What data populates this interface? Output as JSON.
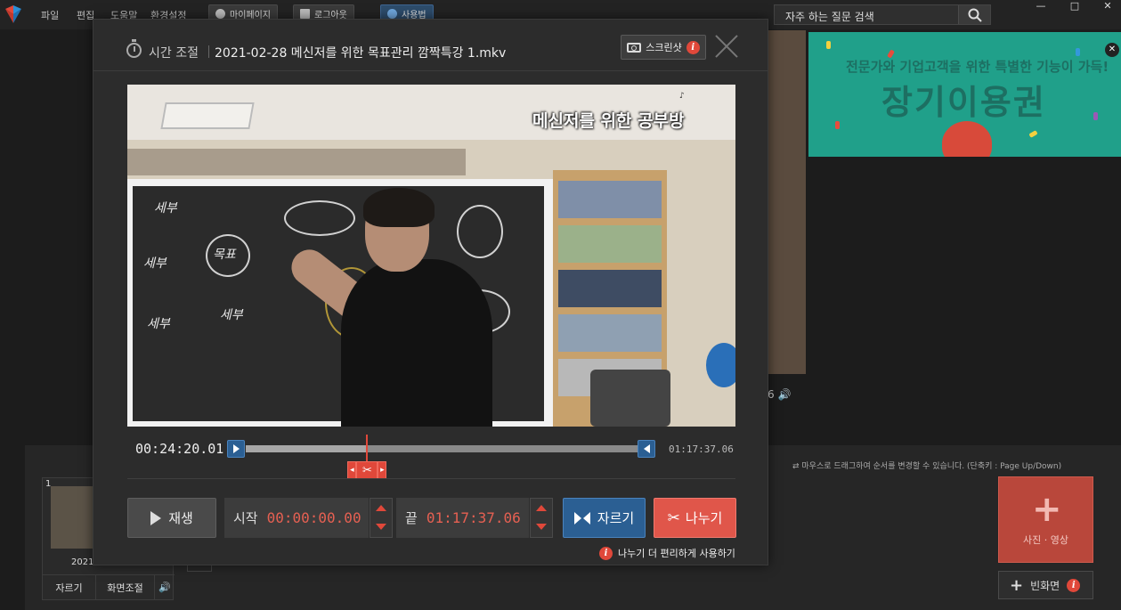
{
  "menubar": {
    "items": [
      "파일",
      "편집",
      "도움말",
      "환경설정"
    ],
    "mypage": "마이페이지",
    "logout": "로그아웃",
    "usage": "사용법",
    "search_placeholder": "자주 하는 질문 검색"
  },
  "dialog": {
    "title": "시간 조절",
    "filename": "2021-02-28 메신저를 위한 목표관리 깜짝특강 1.mkv",
    "screenshot_label": "스크린샷",
    "video_overlay_title": "메신저를 위한 공부방",
    "current_time": "00:24:20.01",
    "end_time": "01:17:37.06",
    "progress_fraction": 0.31,
    "play_label": "재생",
    "start_label": "시작",
    "start_value": "00:00:00.00",
    "end_label": "끝",
    "end_value": "01:17:37.06",
    "cut_label": "자르기",
    "split_label": "나누기",
    "split_hint": "나누기 더 편리하게 사용하기"
  },
  "ad": {
    "line1": "전문가와 기업고객을 위한 특별한 기능이 가득!",
    "line2": "장기이용권"
  },
  "background": {
    "drag_hint": "마우스로 드래그하여 순서를 변경할 수 있습니다. (단축키 : Page Up/Down)",
    "thumb_number": "1",
    "thumb_label": "2021",
    "thumb_cut": "자르기",
    "thumb_screen": "화면조절",
    "bg_number": "6",
    "add_media_label": "사진 · 영상",
    "blank_screen_label": "빈화면"
  },
  "colors": {
    "accent_red": "#e0483a",
    "accent_blue": "#2b5f93",
    "ad_green": "#20a08a"
  }
}
